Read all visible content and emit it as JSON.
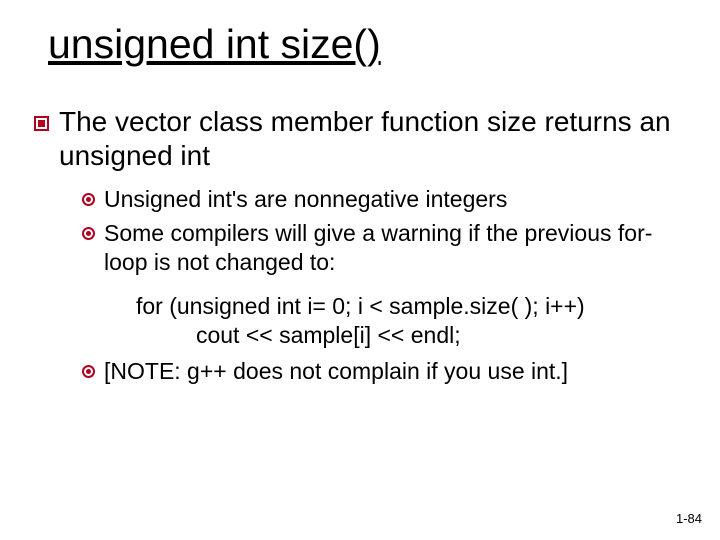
{
  "title": "unsigned int size()",
  "main_bullet": "The vector class member function size returns an unsigned int",
  "sub": {
    "a": "Unsigned int's are nonnegative integers",
    "b": "Some compilers will give a warning if the previous for-loop is not changed to:",
    "c": "[NOTE: g++ does not complain if you use int.]"
  },
  "code": {
    "line1": "for (unsigned int i= 0; i < sample.size( ); i++)",
    "line2": "cout << sample[i] << endl;"
  },
  "page_num": "1-84"
}
